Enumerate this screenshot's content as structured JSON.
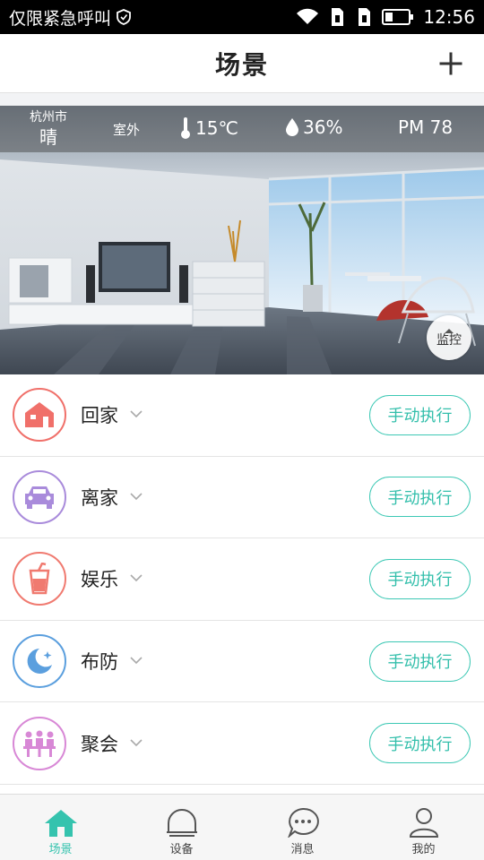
{
  "status_bar": {
    "carrier_text": "仅限紧急呼叫",
    "time": "12:56",
    "icons": [
      "shield-icon",
      "wifi-icon",
      "sim1-icon",
      "sim2-icon",
      "battery-icon"
    ]
  },
  "header": {
    "title": "场景",
    "add_icon": "plus-icon"
  },
  "banner": {
    "city": "杭州市",
    "condition": "晴",
    "outdoor_label": "室外",
    "temperature": "15℃",
    "humidity": "36%",
    "pm": "PM 78",
    "monitor_label": "监控"
  },
  "scenes": [
    {
      "name": "回家",
      "icon": "home-icon",
      "color": "#f0706a",
      "button": "手动执行"
    },
    {
      "name": "离家",
      "icon": "car-icon",
      "color": "#a98bdb",
      "button": "手动执行"
    },
    {
      "name": "娱乐",
      "icon": "drink-icon",
      "color": "#f07a70",
      "button": "手动执行"
    },
    {
      "name": "布防",
      "icon": "moon-icon",
      "color": "#5b9fde",
      "button": "手动执行"
    },
    {
      "name": "聚会",
      "icon": "party-icon",
      "color": "#d888d6",
      "button": "手动执行"
    }
  ],
  "nav": {
    "items": [
      {
        "label": "场景",
        "icon": "home-icon",
        "active": true
      },
      {
        "label": "设备",
        "icon": "device-icon",
        "active": false
      },
      {
        "label": "消息",
        "icon": "message-icon",
        "active": false
      },
      {
        "label": "我的",
        "icon": "user-icon",
        "active": false
      }
    ]
  },
  "colors": {
    "accent": "#35c3ae",
    "divider": "#e4e4e4"
  }
}
